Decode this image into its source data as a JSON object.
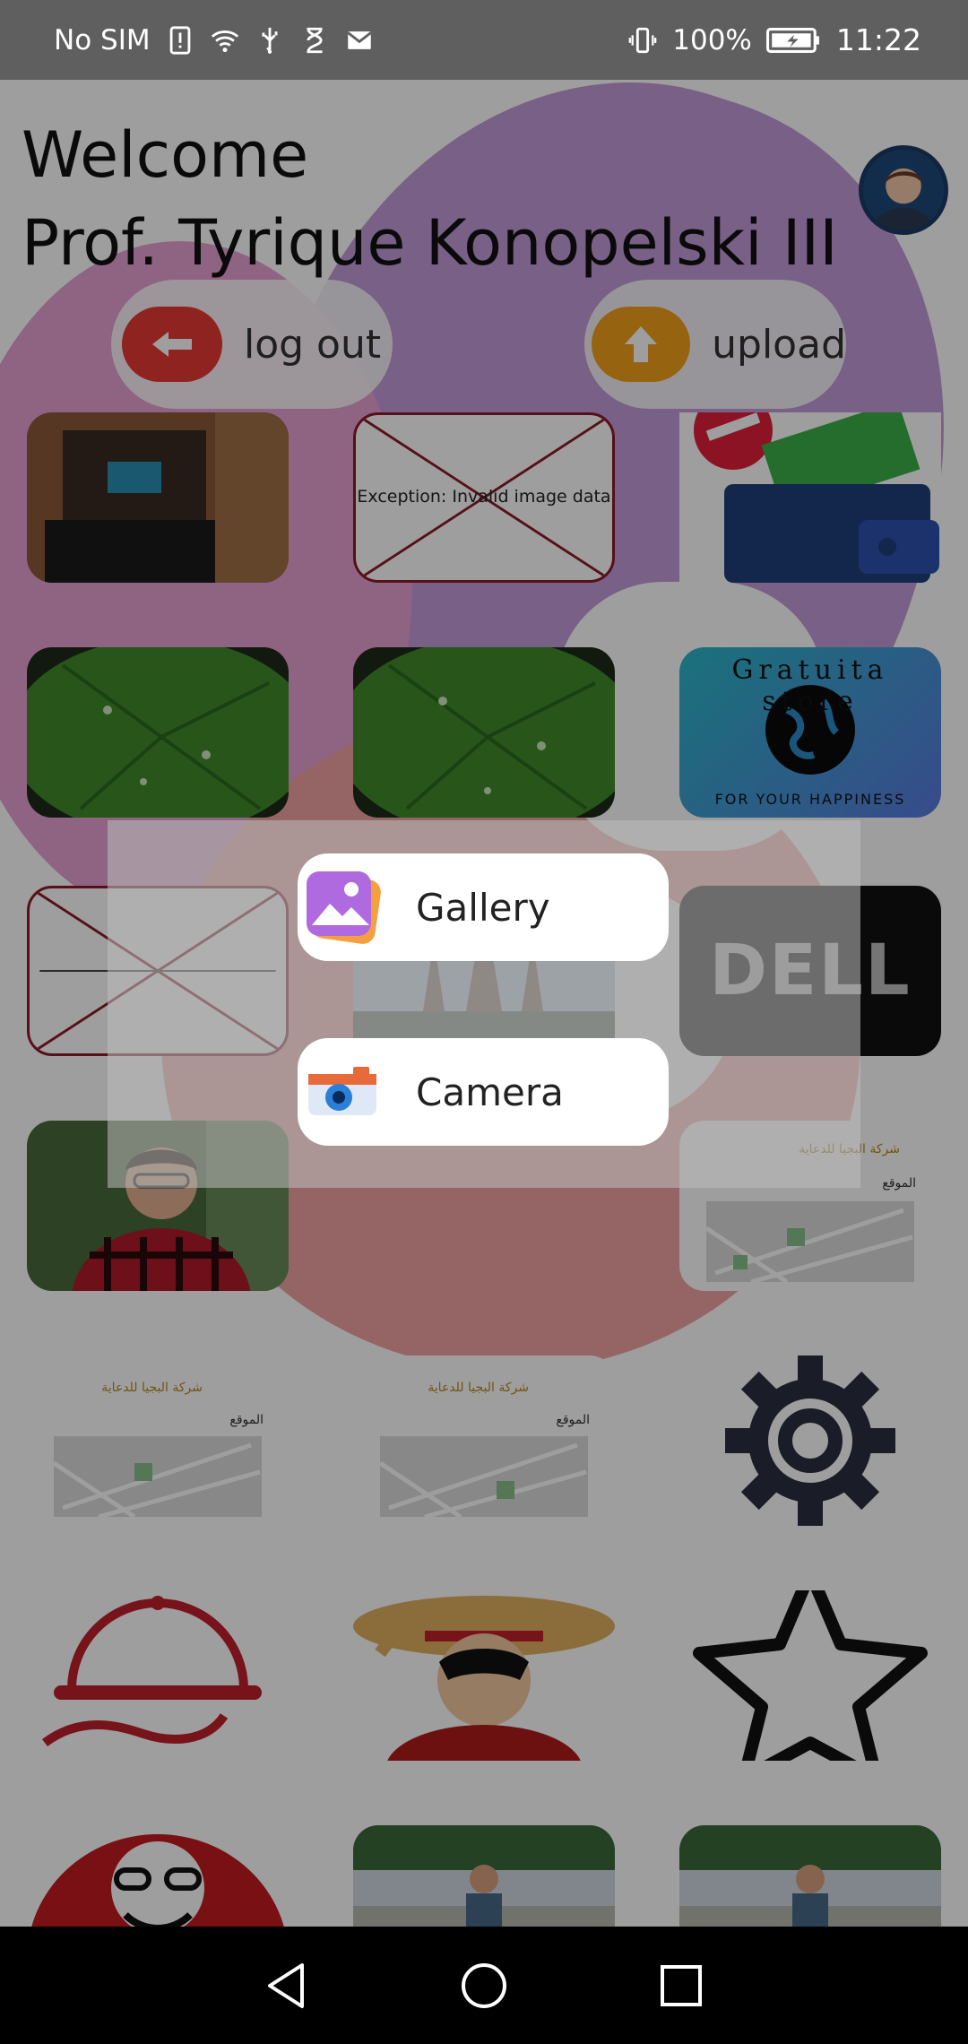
{
  "status_bar": {
    "carrier": "No SIM",
    "battery": "100%",
    "time": "11:22",
    "icons": [
      "sim-alert-icon",
      "wifi-icon",
      "usb-icon",
      "hourglass-icon",
      "mail-icon",
      "vibrate-icon",
      "battery-charging-icon"
    ]
  },
  "header": {
    "welcome": "Welcome",
    "user_name": "Prof. Tyrique Konopelski III"
  },
  "actions": {
    "logout_label": "log out",
    "upload_label": "upload"
  },
  "grid": {
    "broken_image_text": "Exception: Invalid image data",
    "store_badge_top": "Gratuita store",
    "store_badge_bottom": "FOR YOUR HAPPINESS",
    "brand_logo": "DELL",
    "map_company": "شركة البجيا للدعاية",
    "map_location": "الموقع"
  },
  "dialog": {
    "gallery_label": "Gallery",
    "camera_label": "Camera"
  },
  "colors": {
    "logout": "#e53935",
    "upload": "#f2a21a",
    "status_bar": "#5f5f5f",
    "nav_bar": "#000000"
  }
}
